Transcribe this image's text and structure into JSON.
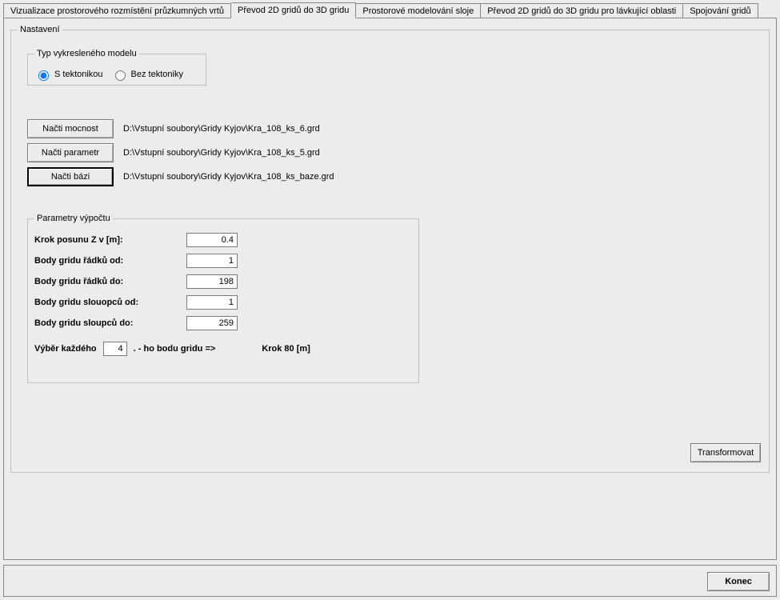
{
  "tabs": {
    "t0": "Vizualizace prostorového rozmístění průzkumných vrtů",
    "t1": "Převod 2D gridů do 3D gridu",
    "t2": "Prostorové modelování sloje",
    "t3": "Převod 2D gridů do 3D gridu pro lávkující oblasti",
    "t4": "Spojování gridů"
  },
  "nastaveni": {
    "legend": "Nastavení",
    "typ": {
      "legend": "Typ vykresleného modelu",
      "opt1": "S tektonikou",
      "opt2": "Bez tektoniky"
    },
    "files": {
      "btn_mocnost": "Načti mocnost",
      "path_mocnost": "D:\\Vstupní soubory\\Gridy Kyjov\\Kra_108_ks_6.grd",
      "btn_parametr": "Načti parametr",
      "path_parametr": "D:\\Vstupní soubory\\Gridy Kyjov\\Kra_108_ks_5.grd",
      "btn_bazi": "Načti bázi",
      "path_bazi": "D:\\Vstupní soubory\\Gridy Kyjov\\Kra_108_ks_baze.grd"
    },
    "params": {
      "legend": "Parametry výpočtu",
      "krok_z_label": "Krok posunu Z v [m]:",
      "krok_z_value": "0.4",
      "radku_od_label": "Body gridu řádků od:",
      "radku_od_value": "1",
      "radku_do_label": "Body gridu řádků do:",
      "radku_do_value": "198",
      "sloupcu_od_label": "Body gridu slouopců od:",
      "sloupcu_od_value": "1",
      "sloupcu_do_label": "Body gridu sloupců do:",
      "sloupcu_do_value": "259",
      "vyber_label": "Výběr každého",
      "vyber_value": "4",
      "vyber_suffix": ". - ho bodu gridu  =>",
      "krok_label": "Krok  80 [m]"
    },
    "transform": "Transformovat"
  },
  "bottom": {
    "konec": "Konec"
  }
}
